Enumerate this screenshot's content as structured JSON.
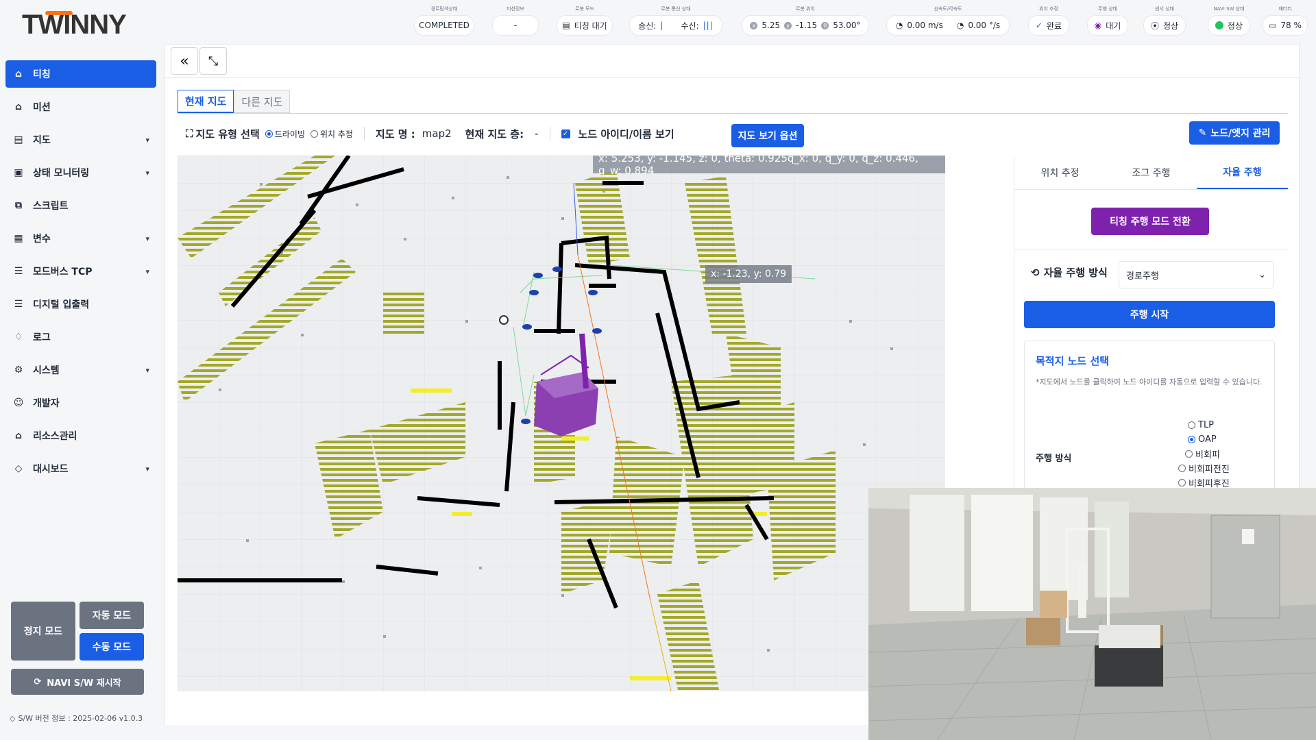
{
  "app": {
    "logo": "TWINNY"
  },
  "sidebar": {
    "items": [
      {
        "label": "티칭",
        "icon": "robot-icon",
        "chevron": false
      },
      {
        "label": "미션",
        "icon": "robot-icon",
        "chevron": false
      },
      {
        "label": "지도",
        "icon": "map-icon",
        "chevron": true
      },
      {
        "label": "상태 모니터링",
        "icon": "monitor-icon",
        "chevron": true
      },
      {
        "label": "스크립트",
        "icon": "script-icon",
        "chevron": false
      },
      {
        "label": "변수",
        "icon": "variable-icon",
        "chevron": true
      },
      {
        "label": "모드버스 TCP",
        "icon": "server-icon",
        "chevron": true
      },
      {
        "label": "디지털 입출력",
        "icon": "server-icon",
        "chevron": false
      },
      {
        "label": "로그",
        "icon": "bulb-icon",
        "chevron": false
      },
      {
        "label": "시스템",
        "icon": "gear-icon",
        "chevron": true
      },
      {
        "label": "개발자",
        "icon": "user-icon",
        "chevron": false
      },
      {
        "label": "리소스관리",
        "icon": "robot-icon",
        "chevron": false
      },
      {
        "label": "대시보드",
        "icon": "diamond-icon",
        "chevron": true
      }
    ],
    "stop_mode": "정지 모드",
    "auto_mode": "자동 모드",
    "manual_mode": "수동 모드",
    "restart": "NAVI S/W 재시작",
    "version": "S/W 버전 정보 : 2025-02-06 v1.0.3"
  },
  "status": {
    "path_state": {
      "label": "경로탐색상태",
      "value": "COMPLETED"
    },
    "mission": {
      "label": "미션정보",
      "value": "-"
    },
    "robot_mode": {
      "label": "로봇 모드",
      "value": "티칭 대기"
    },
    "comm": {
      "label": "로봇 통신 상태",
      "send": "송신:",
      "recv": "수신:"
    },
    "position": {
      "label": "로봇 위치",
      "x": "5.25",
      "y": "-1.15",
      "theta": "53.00°"
    },
    "velocity": {
      "label": "선속도/각속도",
      "linear": "0.00 m/s",
      "angular": "0.00 °/s"
    },
    "localization": {
      "label": "위치 추정",
      "value": "완료"
    },
    "drive_state": {
      "label": "주행 상태",
      "value": "대기"
    },
    "sensor": {
      "label": "센서 상태",
      "value": "정상"
    },
    "navi_sw": {
      "label": "NAVI SW 상태",
      "value": "정상"
    },
    "battery": {
      "label": "배터리",
      "value": "78 %"
    }
  },
  "main": {
    "tabs": [
      "현재 지도",
      "다른 지도"
    ],
    "map_type_label": "지도 유형 선택",
    "map_type_options": [
      "드라이빙",
      "위치 추정"
    ],
    "map_name_label": "지도 명 :",
    "map_name": "map2",
    "floor_label": "현재 지도 층:",
    "floor": "-",
    "show_node_label": "노드 아이디/이름 보기",
    "map_view_option": "지도 보기 옵션",
    "node_edge_manage": "노드/엣지 관리",
    "coord_readout": "x: 5.253, y: -1.145, z: 0, theta: 0.925q_x: 0, q_y: 0, q_z: 0.446, q_w: 0.894",
    "cursor_readout": "x: -1.23, y: 0.79"
  },
  "right_panel": {
    "tabs": [
      "위치 추정",
      "조그 주행",
      "자율 주행"
    ],
    "teaching_mode_switch": "티칭 주행 모드 전환",
    "auto_method_label": "자율 주행 방식",
    "auto_method_value": "경로주행",
    "start": "주행 시작",
    "dest_title": "목적지 노드 선택",
    "dest_note": "*지도에서 노드를 클릭하여 노드 아이디를 자동으로 입력할 수 있습니다.",
    "drive_label": "주행 방식",
    "drive_options": [
      "TLP",
      "OAP",
      "비회피",
      "비회피전진",
      "비회피후진"
    ],
    "drive_selected": "OAP"
  },
  "colors": {
    "accent": "#1b5ee6",
    "purple": "#7e22ae",
    "point_cloud": "#a3a829",
    "obstacle": "#000000",
    "robot": "#8b3fb0"
  }
}
